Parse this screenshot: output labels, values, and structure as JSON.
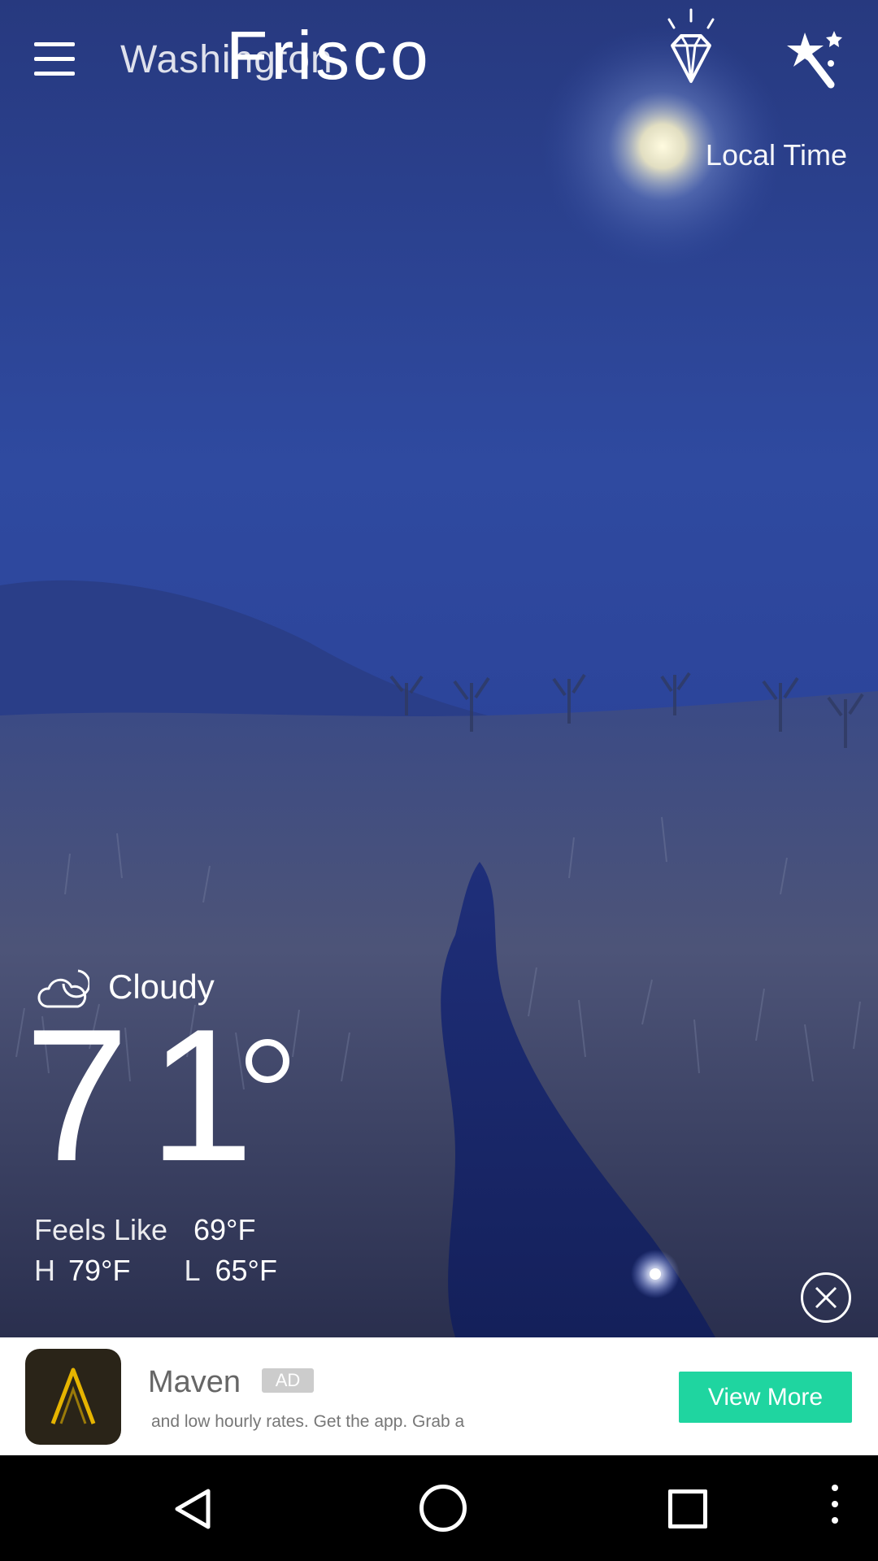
{
  "header": {
    "old_city": "Washington",
    "city": "Frisco",
    "local_time_label": "Local Time"
  },
  "weather": {
    "condition": "Cloudy",
    "condition_icon": "cloud-moon-icon",
    "temperature": "71",
    "feels_like_label": "Feels Like",
    "feels_like_value": "69°F",
    "high_label": "H",
    "high_value": "79°F",
    "low_label": "L",
    "low_value": "65°F"
  },
  "ad": {
    "app_name": "Maven",
    "badge": "AD",
    "description": "and low hourly rates. Get the app. Grab a",
    "cta": "View More"
  },
  "colors": {
    "ad_cta": "#1fd5a0",
    "sky_top": "#2a3f8f",
    "ground": "#2b3254"
  },
  "icons": [
    "menu-icon",
    "diamond-icon",
    "magic-wand-icon",
    "close-circle-icon",
    "back-icon",
    "home-icon",
    "recent-apps-icon",
    "more-icon"
  ]
}
